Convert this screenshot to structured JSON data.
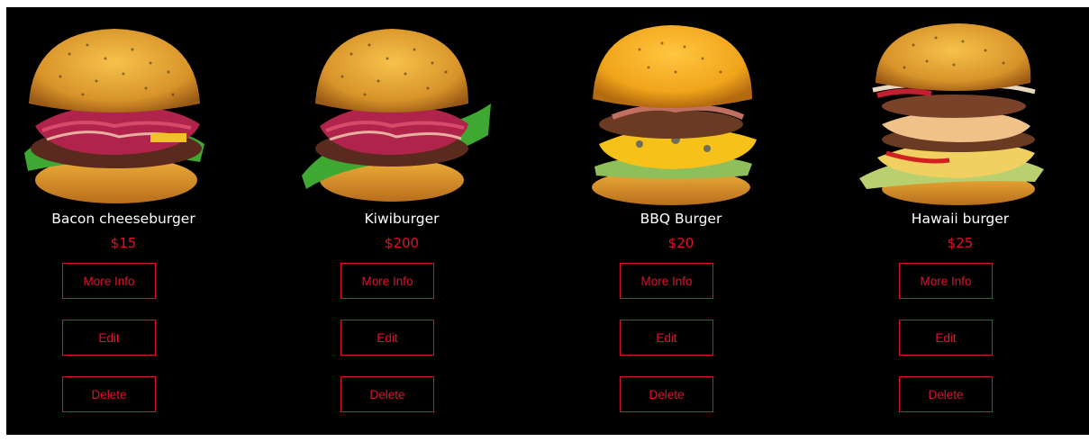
{
  "buttons": {
    "more_info": "More Info",
    "edit": "Edit",
    "delete": "Delete"
  },
  "accent_color": "#e0102a",
  "products": [
    {
      "name": "Bacon cheeseburger",
      "price": "$15",
      "image": "burger-image"
    },
    {
      "name": "Kiwiburger",
      "price": "$200",
      "image": "burger-image"
    },
    {
      "name": "BBQ Burger",
      "price": "$20",
      "image": "burger-image"
    },
    {
      "name": "Hawaii burger",
      "price": "$25",
      "image": "burger-image"
    }
  ]
}
